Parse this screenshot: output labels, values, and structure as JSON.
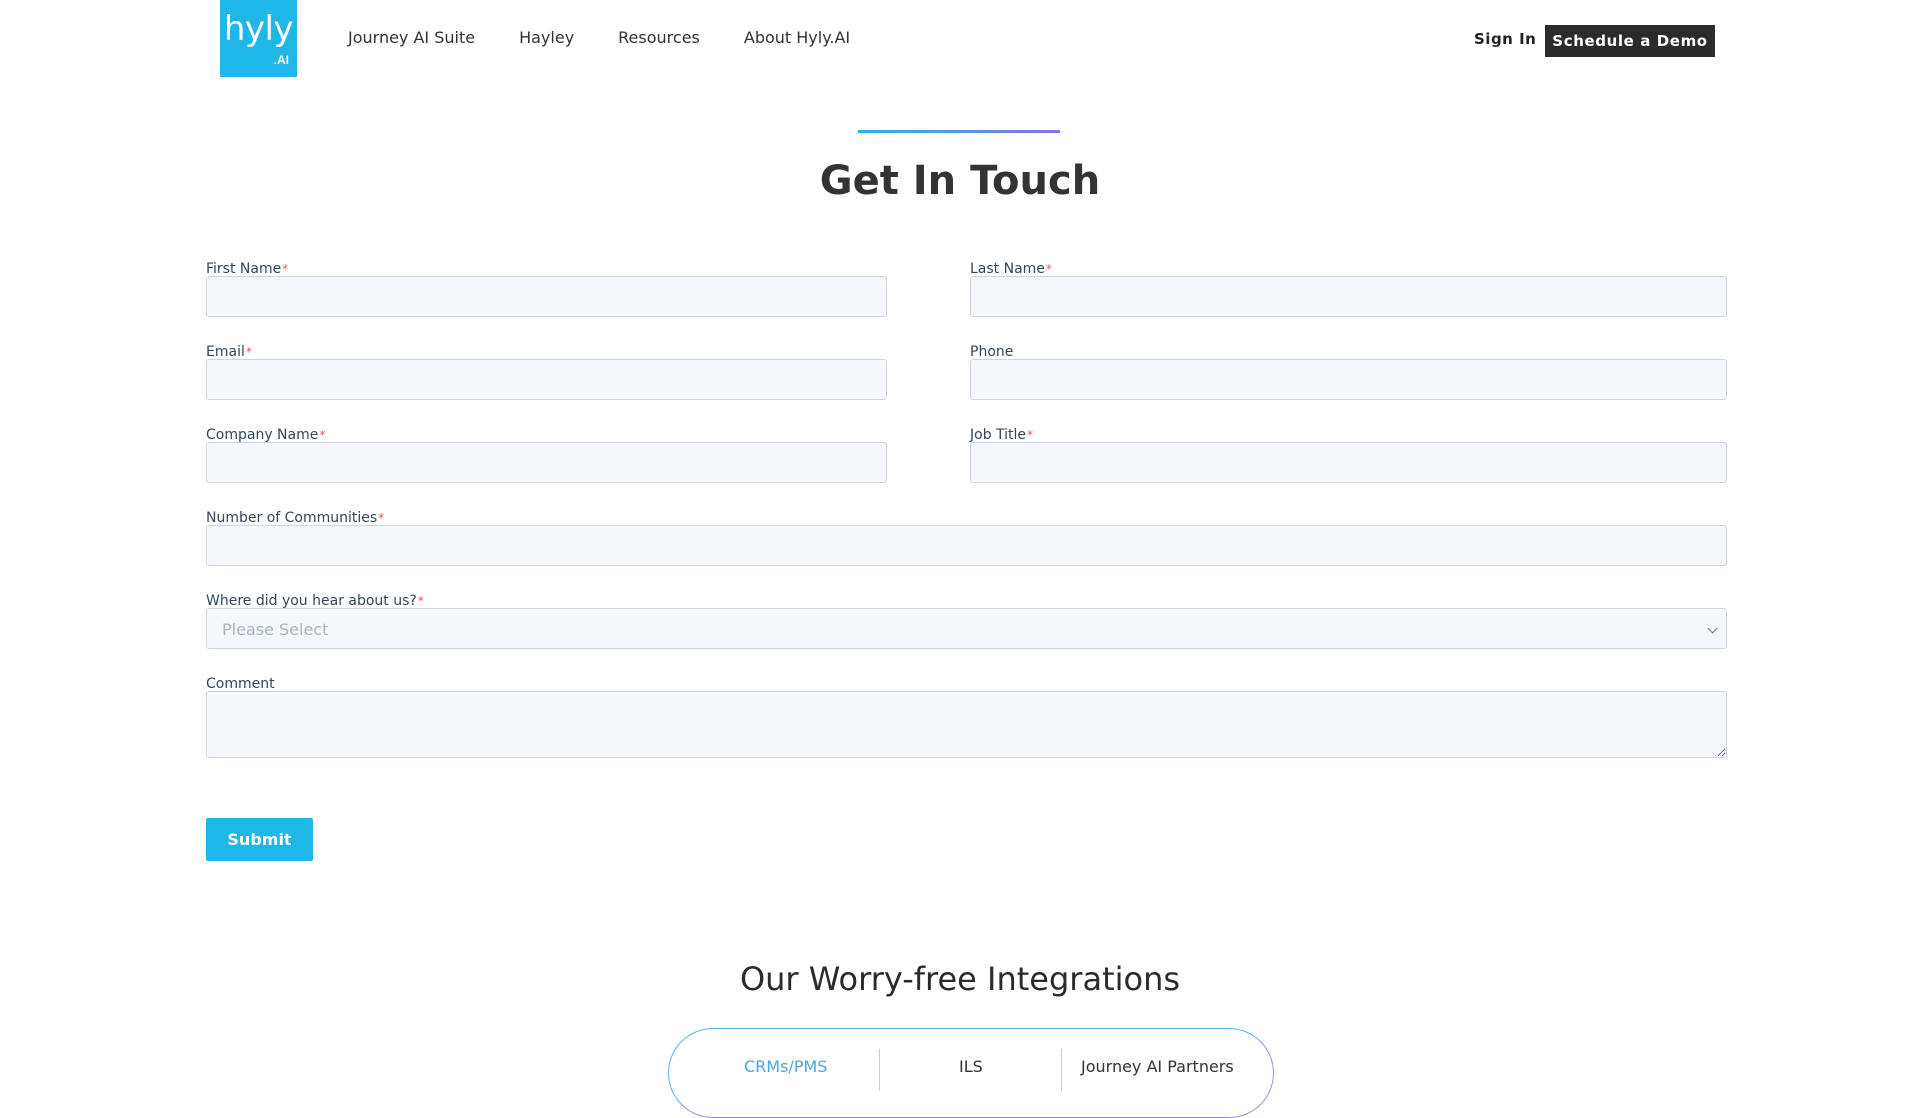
{
  "header": {
    "logo_text": "hyly",
    "logo_sub": ".AI",
    "nav": [
      "Journey AI Suite",
      "Hayley",
      "Resources",
      "About Hyly.AI"
    ],
    "sign_in": "Sign In",
    "cta": "Schedule a Demo"
  },
  "page": {
    "title": "Get In Touch"
  },
  "form": {
    "first_name_label": "First Name",
    "last_name_label": "Last Name",
    "email_label": "Email",
    "phone_label": "Phone",
    "company_label": "Company Name",
    "job_title_label": "Job Title",
    "communities_label": "Number of Communities",
    "source_label": "Where did you hear about us?",
    "source_selected": "Please Select",
    "comment_label": "Comment",
    "required_mark": "*",
    "submit_label": "Submit"
  },
  "integrations": {
    "title": "Our Worry-free Integrations",
    "tabs": [
      "CRMs/PMS",
      "ILS",
      "Journey AI Partners"
    ],
    "active_tab": 0
  },
  "colors": {
    "brand": "#1fb6e8",
    "dark_button": "#2b2b2b",
    "required": "#f2545b",
    "input_bg": "#f5f8fa"
  }
}
